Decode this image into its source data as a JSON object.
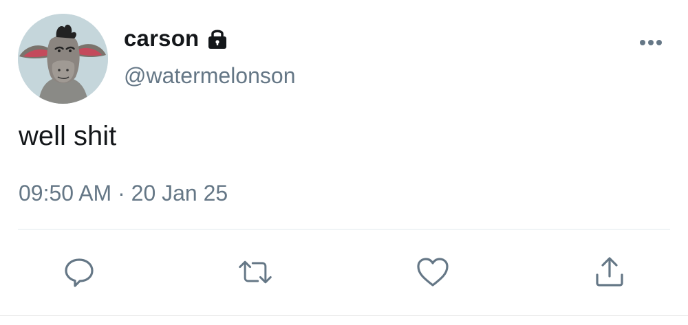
{
  "tweet": {
    "display_name": "carson",
    "handle": "@watermelonson",
    "text": "well shit",
    "timestamp": "09:50 AM · 20 Jan 25",
    "protected": true
  },
  "icons": {
    "lock": "lock-icon",
    "more": "more-options-icon",
    "reply": "reply-icon",
    "retweet": "retweet-icon",
    "like": "heart-icon",
    "share": "share-icon"
  },
  "colors": {
    "text": "#14171a",
    "secondary": "#657786",
    "divider": "#e1e8ed"
  }
}
